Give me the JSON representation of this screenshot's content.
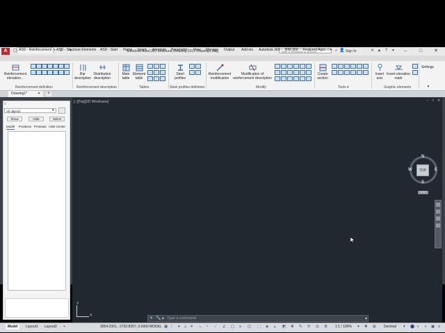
{
  "window": {
    "app_logo": "A",
    "title": "Autodesk AutoCAD Structural Detailing 2015     Drawing1.dwg",
    "search_placeholder": "Type a keyword or phrase",
    "sign_in": "Sign In",
    "minimize": "–",
    "maximize": "□",
    "close": "✕"
  },
  "ribbon_tabs": [
    "ASD - Reinforcement",
    "ASD - Structure Elements",
    "ASD - Start",
    "Home",
    "Insert",
    "Annotate",
    "Parametric",
    "View",
    "Manage",
    "Output",
    "Add-ins",
    "Autodesk 360",
    "BIM 360",
    "Featured Apps"
  ],
  "ribbon": {
    "reinforcement_elevation": "Reinforcement elevation...",
    "bar_description": "Bar description",
    "distribution_description": "Distribution description",
    "main_table": "Main table",
    "element_table": "Element table",
    "steel_profiles": "Steel profiles",
    "reinforcement_modification": "Reinforcement modification",
    "modification_reinforcement_description": "Modification of reinforcement description",
    "create_section": "Create section",
    "insert_axis": "Insert axis",
    "insert_elevation_mark": "Insert elevation mark",
    "settings": "Settings",
    "panels": {
      "reinforcement_definition": "Reinforcement definition",
      "reinforcement_description": "Reinforcement description",
      "tables": "Tables",
      "steel_profiles_definition": "Steel profiles definition",
      "modify": "Modify",
      "tools": "Tools ▾",
      "graphic_elements": "Graphic elements"
    }
  },
  "file_tabs": {
    "active": "Drawing1*",
    "close": "✕",
    "new": "+"
  },
  "left_panel": {
    "filter_value": "All objects",
    "show": "Show",
    "hide": "Hide",
    "select": "Select",
    "tabs": [
      "Model",
      "Positions",
      "Printouts",
      "ASD Center"
    ]
  },
  "viewport": {
    "label": "[−][Top][2D Wireframe]",
    "cube_top": "TOP",
    "compass_n": "N",
    "compass_s": "S",
    "compass_e": "E",
    "compass_w": "W",
    "wcs": "WCS",
    "ucs_x": "X",
    "ucs_y": "Y",
    "min": "–",
    "restore": "□",
    "close": "✕"
  },
  "command_line": {
    "placeholder": "Type a command",
    "prompt_icon": "▶",
    "close_icon": "✕",
    "custom_icon": "🔧"
  },
  "status_bar": {
    "layout_tabs": [
      "Model",
      "Layout1",
      "Layout2"
    ],
    "add_layout": "+",
    "coordinates": "3554.2301, -2733.8357, 0.0000",
    "space": "MODEL",
    "scale": "1:1 / 100%",
    "units": "Decimal"
  },
  "colors": {
    "viewport_bg": "#212830",
    "ribbon_bg": "#f3f3f3",
    "accent_blue": "#3a6ea8",
    "logo_red": "#c0262d"
  }
}
